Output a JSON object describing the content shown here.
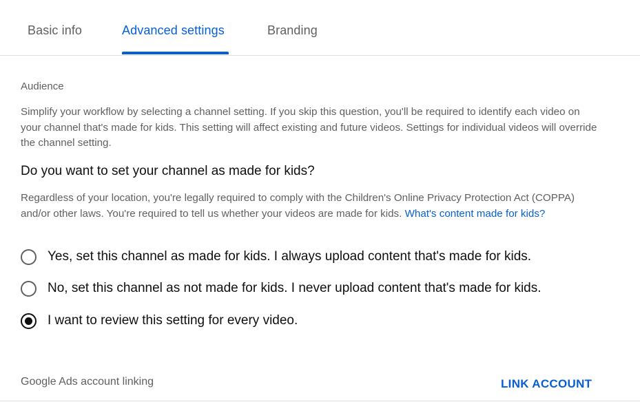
{
  "tabs": [
    {
      "label": "Basic info",
      "active": false
    },
    {
      "label": "Advanced settings",
      "active": true
    },
    {
      "label": "Branding",
      "active": false
    }
  ],
  "audience": {
    "label": "Audience",
    "description": "Simplify your workflow by selecting a channel setting. If you skip this question, you'll be required to identify each video on your channel that's made for kids. This setting will affect existing and future videos. Settings for individual videos will override the channel setting.",
    "question": "Do you want to set your channel as made for kids?",
    "legal_text": "Regardless of your location, you're legally required to comply with the Children's Online Privacy Protection Act (COPPA) and/or other laws. You're required to tell us whether your videos are made for kids.",
    "legal_link": "What's content made for kids?",
    "options": [
      {
        "label": "Yes, set this channel as made for kids. I always upload content that's made for kids.",
        "selected": false
      },
      {
        "label": "No, set this channel as not made for kids. I never upload content that's made for kids.",
        "selected": false
      },
      {
        "label": "I want to review this setting for every video.",
        "selected": true
      }
    ]
  },
  "ads": {
    "label": "Google Ads account linking",
    "button_label": "LINK ACCOUNT"
  },
  "colors": {
    "accent": "#065fd4",
    "text_primary": "#0f0f0f",
    "text_secondary": "#606060",
    "divider": "#e0e0e0"
  }
}
